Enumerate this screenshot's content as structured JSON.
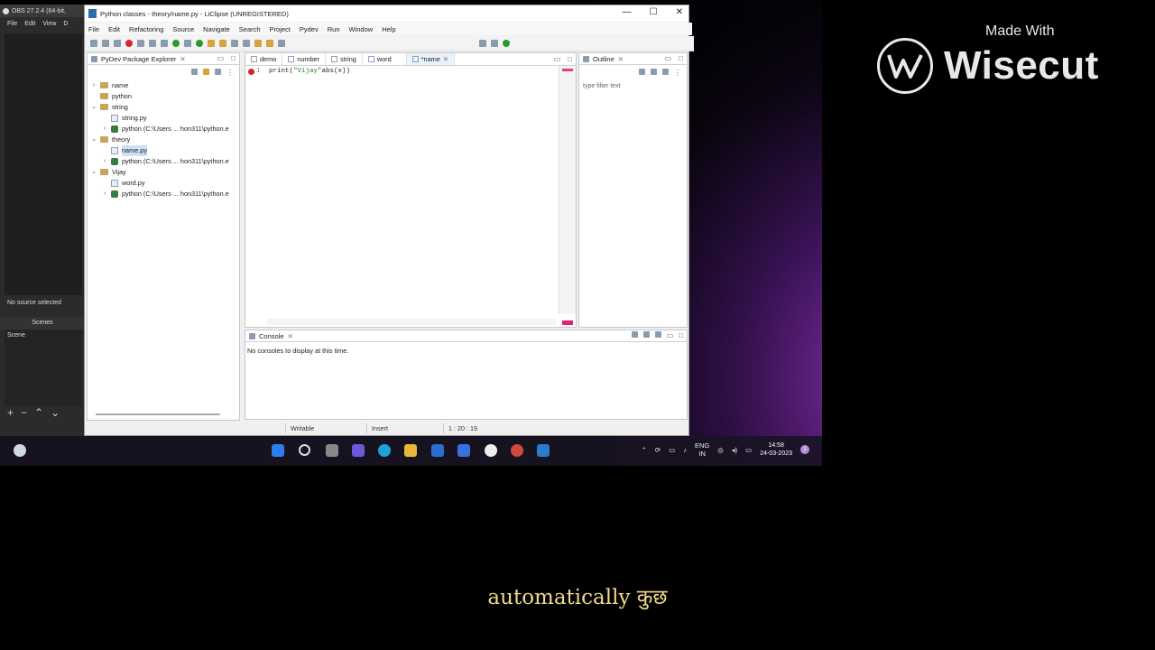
{
  "obs": {
    "title": "OBS 27.2.4 (64-bit,",
    "menu": [
      "File",
      "Edit",
      "View",
      "D"
    ],
    "no_source": "No source selected",
    "scenes_header": "Scenes",
    "scene_item": "Scene",
    "controls": [
      "+",
      "−",
      "⌃",
      "⌄"
    ]
  },
  "window": {
    "title": "Python classes - theory/name.py - LiClipse (UNREGISTERED)",
    "controls": [
      "—",
      "☐",
      "✕"
    ],
    "menu": [
      "File",
      "Edit",
      "Refactoring",
      "Source",
      "Navigate",
      "Search",
      "Project",
      "Pydev",
      "Run",
      "Window",
      "Help"
    ]
  },
  "package_explorer": {
    "tab_label": "PyDev Package Explorer",
    "tree": [
      {
        "label": "name",
        "type": "folder",
        "level": 0,
        "expanded": false
      },
      {
        "label": "python",
        "type": "folder",
        "level": 0,
        "expanded": null
      },
      {
        "label": "string",
        "type": "folder",
        "level": 0,
        "expanded": true
      },
      {
        "label": "string.py",
        "type": "file",
        "level": 1
      },
      {
        "label": "python  (C:\\Users ... hon311\\python.e",
        "type": "lib",
        "level": 1,
        "expanded": false
      },
      {
        "label": "theory",
        "type": "folder",
        "level": 0,
        "expanded": true
      },
      {
        "label": "name.py",
        "type": "file",
        "level": 1,
        "selected": true
      },
      {
        "label": "python  (C:\\Users ... hon311\\python.e",
        "type": "lib",
        "level": 1,
        "expanded": false
      },
      {
        "label": "Vijay",
        "type": "folder",
        "level": 0,
        "expanded": true
      },
      {
        "label": "word.py",
        "type": "file",
        "level": 1
      },
      {
        "label": "python  (C:\\Users ... hon311\\python.e",
        "type": "lib",
        "level": 1,
        "expanded": false
      }
    ]
  },
  "editor": {
    "tabs": [
      {
        "label": "demo",
        "active": false
      },
      {
        "label": "number",
        "active": false
      },
      {
        "label": "string",
        "active": false
      },
      {
        "label": "word",
        "active": false
      },
      {
        "label": "*name",
        "active": true
      }
    ],
    "line_number": "1",
    "code_prefix": "print(",
    "code_string": "\"Vijay\"",
    "code_suffix": "abs(x))"
  },
  "outline": {
    "tab_label": "Outline",
    "filter_placeholder": "type filter text"
  },
  "console": {
    "tab_label": "Console",
    "message": "No consoles to display at this time."
  },
  "status_bar": {
    "writable": "Writable",
    "mode": "Insert",
    "position": "1 : 20 : 19"
  },
  "taskbar": {
    "lang_top": "ENG",
    "lang_bottom": "IN",
    "time": "14:58",
    "date": "24-03-2023",
    "notification_count": "1"
  },
  "watermark": {
    "made_with": "Made With",
    "brand": "Wisecut"
  },
  "caption": "automatically कुछ"
}
